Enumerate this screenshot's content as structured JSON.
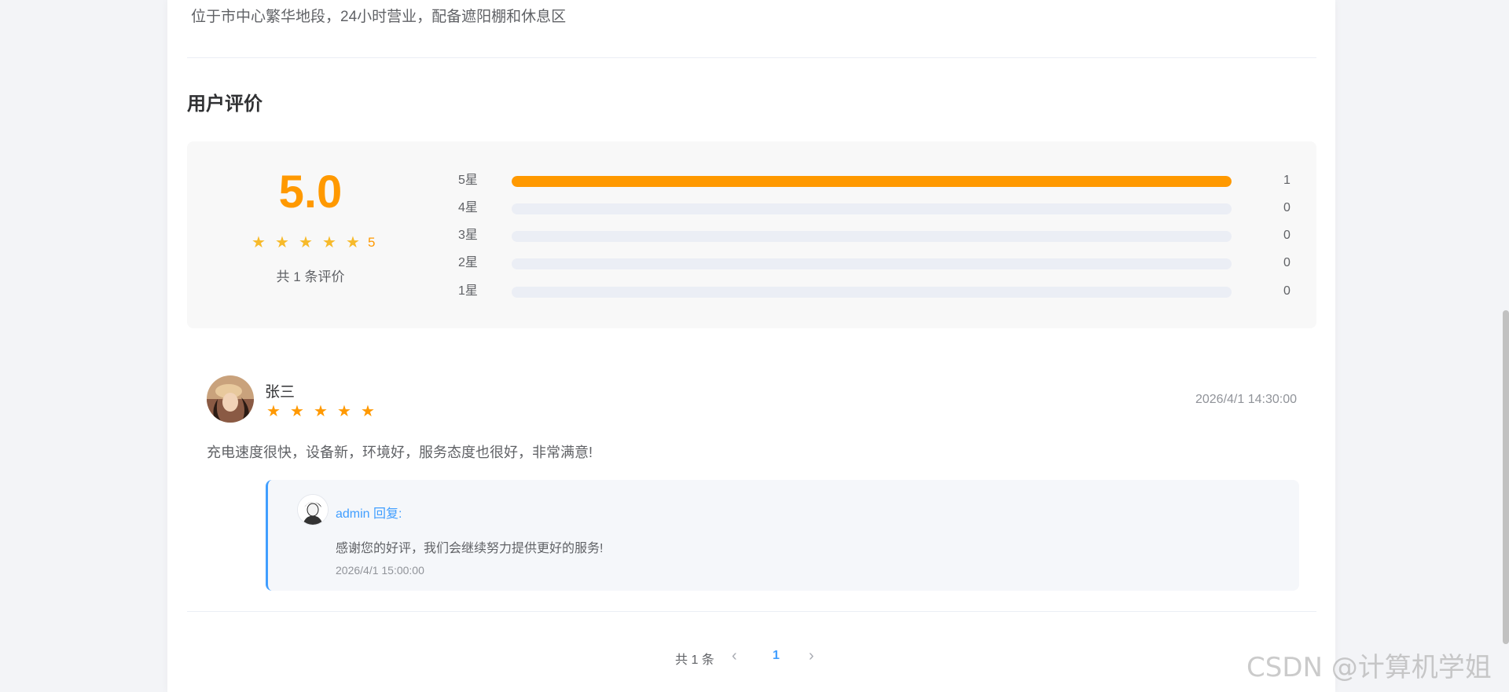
{
  "station": {
    "description": "位于市中心繁华地段，24小时营业，配备遮阳棚和休息区"
  },
  "reviews_section": {
    "title": "用户评价",
    "average_score": "5.0",
    "average_stars": 5,
    "average_label": "5",
    "total_text": "共 1 条评价",
    "distribution": [
      {
        "label": "5星",
        "count": "1",
        "fraction": 1.0
      },
      {
        "label": "4星",
        "count": "0",
        "fraction": 0
      },
      {
        "label": "3星",
        "count": "0",
        "fraction": 0
      },
      {
        "label": "2星",
        "count": "0",
        "fraction": 0
      },
      {
        "label": "1星",
        "count": "0",
        "fraction": 0
      }
    ]
  },
  "review": {
    "user_name": "张三",
    "rating": 5,
    "time": "2026/4/1 14:30:00",
    "content": "充电速度很快，设备新，环境好，服务态度也很好，非常满意!",
    "reply": {
      "author": "admin 回复:",
      "content": "感谢您的好评，我们会继续努力提供更好的服务!",
      "time": "2026/4/1 15:00:00"
    }
  },
  "pagination": {
    "total_text": "共 1 条",
    "current_page": "1",
    "prev_icon": "‹",
    "next_icon": "›"
  },
  "watermark": "CSDN @计算机学姐",
  "colors": {
    "accent": "#ff9900",
    "link": "#409eff"
  }
}
